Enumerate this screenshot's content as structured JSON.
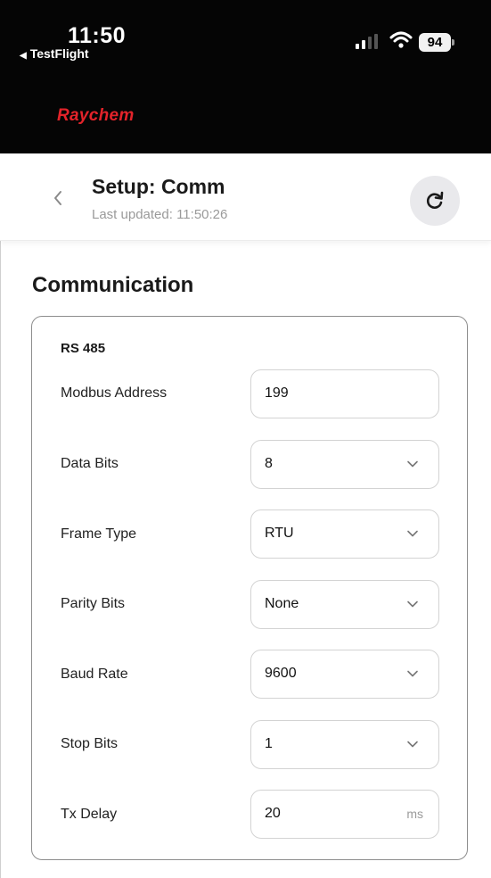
{
  "status_bar": {
    "time": "11:50",
    "back_app": "TestFlight",
    "battery": "94"
  },
  "brand": {
    "logo_text": "Raychem",
    "color": "#e3232a"
  },
  "header": {
    "title": "Setup: Comm",
    "last_updated": "Last updated: 11:50:26"
  },
  "section": {
    "title": "Communication"
  },
  "card": {
    "title": "RS 485",
    "rows": [
      {
        "label": "Modbus Address",
        "value": "199",
        "kind": "input"
      },
      {
        "label": "Data Bits",
        "value": "8",
        "kind": "select"
      },
      {
        "label": "Frame Type",
        "value": "RTU",
        "kind": "select"
      },
      {
        "label": "Parity Bits",
        "value": "None",
        "kind": "select"
      },
      {
        "label": "Baud Rate",
        "value": "9600",
        "kind": "select"
      },
      {
        "label": "Stop Bits",
        "value": "1",
        "kind": "select"
      },
      {
        "label": "Tx Delay",
        "value": "20",
        "unit": "ms",
        "kind": "input"
      }
    ]
  }
}
